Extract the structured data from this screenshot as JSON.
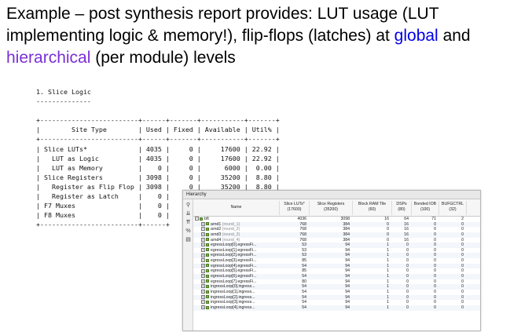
{
  "slide": {
    "heading_part1": "Example – post synthesis report provides: LUT usage (LUT implementing logic & memory!), flip-flops (latches) at ",
    "heading_global": "global",
    "heading_and": " and ",
    "heading_hier": "hierarchical",
    "heading_part2": " (per module) levels",
    "colors": {
      "global": "#0000e6",
      "hierarchical": "#7a2fd6"
    }
  },
  "report": {
    "lines": [
      "1. Slice Logic",
      "--------------",
      "",
      "+-------------------------+------+-------+-----------+-------+",
      "|        Site Type        | Used | Fixed | Available | Util% |",
      "+-------------------------+------+-------+-----------+-------+",
      "| Slice LUTs*             | 4035 |     0 |     17600 | 22.92 |",
      "|   LUT as Logic          | 4035 |     0 |     17600 | 22.92 |",
      "|   LUT as Memory         |    0 |     0 |      6000 |  0.00 |",
      "| Slice Registers         | 3098 |     0 |     35200 |  8.80 |",
      "|   Register as Flip Flop | 3098 |     0 |     35200 |  8.80 |",
      "|   Register as Latch     |    0 |",
      "| F7 Muxes                |    0 |",
      "| F8 Muxes                |    0 |",
      "+-------------------------+------+"
    ]
  },
  "hierarchy": {
    "title": "Hierarchy",
    "toolbar_icons": [
      "search-icon",
      "collapse-all-icon",
      "expand-all-icon",
      "percent-icon",
      "report-icon"
    ],
    "toolbar_glyphs": [
      "⚲",
      "⇊",
      "⇈",
      "%",
      "▤"
    ],
    "columns": [
      {
        "label": "Name",
        "sub": ""
      },
      {
        "label": "Slice LUTs*",
        "sub": "(17600)"
      },
      {
        "label": "Slice Registers",
        "sub": "(35200)"
      },
      {
        "label": "Block RAM Tile",
        "sub": "(60)"
      },
      {
        "label": "DSPs",
        "sub": "(80)"
      },
      {
        "label": "Bonded IOB",
        "sub": "(100)"
      },
      {
        "label": "BUFGCTRL",
        "sub": "(32)"
      }
    ],
    "rows": [
      {
        "name": "bft",
        "sub": "",
        "luts": "4036",
        "regs": "3098",
        "bram": "16",
        "dsps": "64",
        "iob": "71",
        "bufg": "2"
      },
      {
        "name": "arnd1",
        "sub": "(round_1)",
        "luts": "768",
        "regs": "384",
        "bram": "0",
        "dsps": "16",
        "iob": "0",
        "bufg": "0"
      },
      {
        "name": "arnd2",
        "sub": "(round_2)",
        "luts": "768",
        "regs": "384",
        "bram": "0",
        "dsps": "16",
        "iob": "0",
        "bufg": "0"
      },
      {
        "name": "arnd3",
        "sub": "(round_3)",
        "luts": "768",
        "regs": "384",
        "bram": "0",
        "dsps": "16",
        "iob": "0",
        "bufg": "0"
      },
      {
        "name": "arnd4",
        "sub": "(round_4)",
        "luts": "768",
        "regs": "384",
        "bram": "0",
        "dsps": "16",
        "iob": "0",
        "bufg": "0"
      },
      {
        "name": "egressLoop[0].egressFi...",
        "sub": "",
        "luts": "53",
        "regs": "94",
        "bram": "1",
        "dsps": "0",
        "iob": "0",
        "bufg": "0"
      },
      {
        "name": "egressLoop[1].egressFi...",
        "sub": "",
        "luts": "53",
        "regs": "94",
        "bram": "1",
        "dsps": "0",
        "iob": "0",
        "bufg": "0"
      },
      {
        "name": "egressLoop[2].egressFi...",
        "sub": "",
        "luts": "53",
        "regs": "94",
        "bram": "1",
        "dsps": "0",
        "iob": "0",
        "bufg": "0"
      },
      {
        "name": "egressLoop[3].egressFi...",
        "sub": "",
        "luts": "85",
        "regs": "94",
        "bram": "1",
        "dsps": "0",
        "iob": "0",
        "bufg": "0"
      },
      {
        "name": "egressLoop[4].egressFi...",
        "sub": "",
        "luts": "54",
        "regs": "94",
        "bram": "1",
        "dsps": "0",
        "iob": "0",
        "bufg": "0"
      },
      {
        "name": "egressLoop[5].egressFi...",
        "sub": "",
        "luts": "85",
        "regs": "94",
        "bram": "1",
        "dsps": "0",
        "iob": "0",
        "bufg": "0"
      },
      {
        "name": "egressLoop[6].egressFi...",
        "sub": "",
        "luts": "54",
        "regs": "94",
        "bram": "1",
        "dsps": "0",
        "iob": "0",
        "bufg": "0"
      },
      {
        "name": "egressLoop[7].egressFi...",
        "sub": "",
        "luts": "80",
        "regs": "94",
        "bram": "1",
        "dsps": "0",
        "iob": "0",
        "bufg": "0"
      },
      {
        "name": "ingressLoop[0].ingress...",
        "sub": "",
        "luts": "54",
        "regs": "94",
        "bram": "1",
        "dsps": "0",
        "iob": "0",
        "bufg": "0"
      },
      {
        "name": "ingressLoop[1].ingress...",
        "sub": "",
        "luts": "54",
        "regs": "94",
        "bram": "1",
        "dsps": "0",
        "iob": "0",
        "bufg": "0"
      },
      {
        "name": "ingressLoop[2].ingress...",
        "sub": "",
        "luts": "54",
        "regs": "94",
        "bram": "1",
        "dsps": "0",
        "iob": "0",
        "bufg": "0"
      },
      {
        "name": "ingressLoop[3].ingress...",
        "sub": "",
        "luts": "54",
        "regs": "94",
        "bram": "1",
        "dsps": "0",
        "iob": "0",
        "bufg": "0"
      },
      {
        "name": "ingressLoop[4].ingress...",
        "sub": "",
        "luts": "54",
        "regs": "94",
        "bram": "1",
        "dsps": "0",
        "iob": "0",
        "bufg": "0"
      }
    ]
  }
}
